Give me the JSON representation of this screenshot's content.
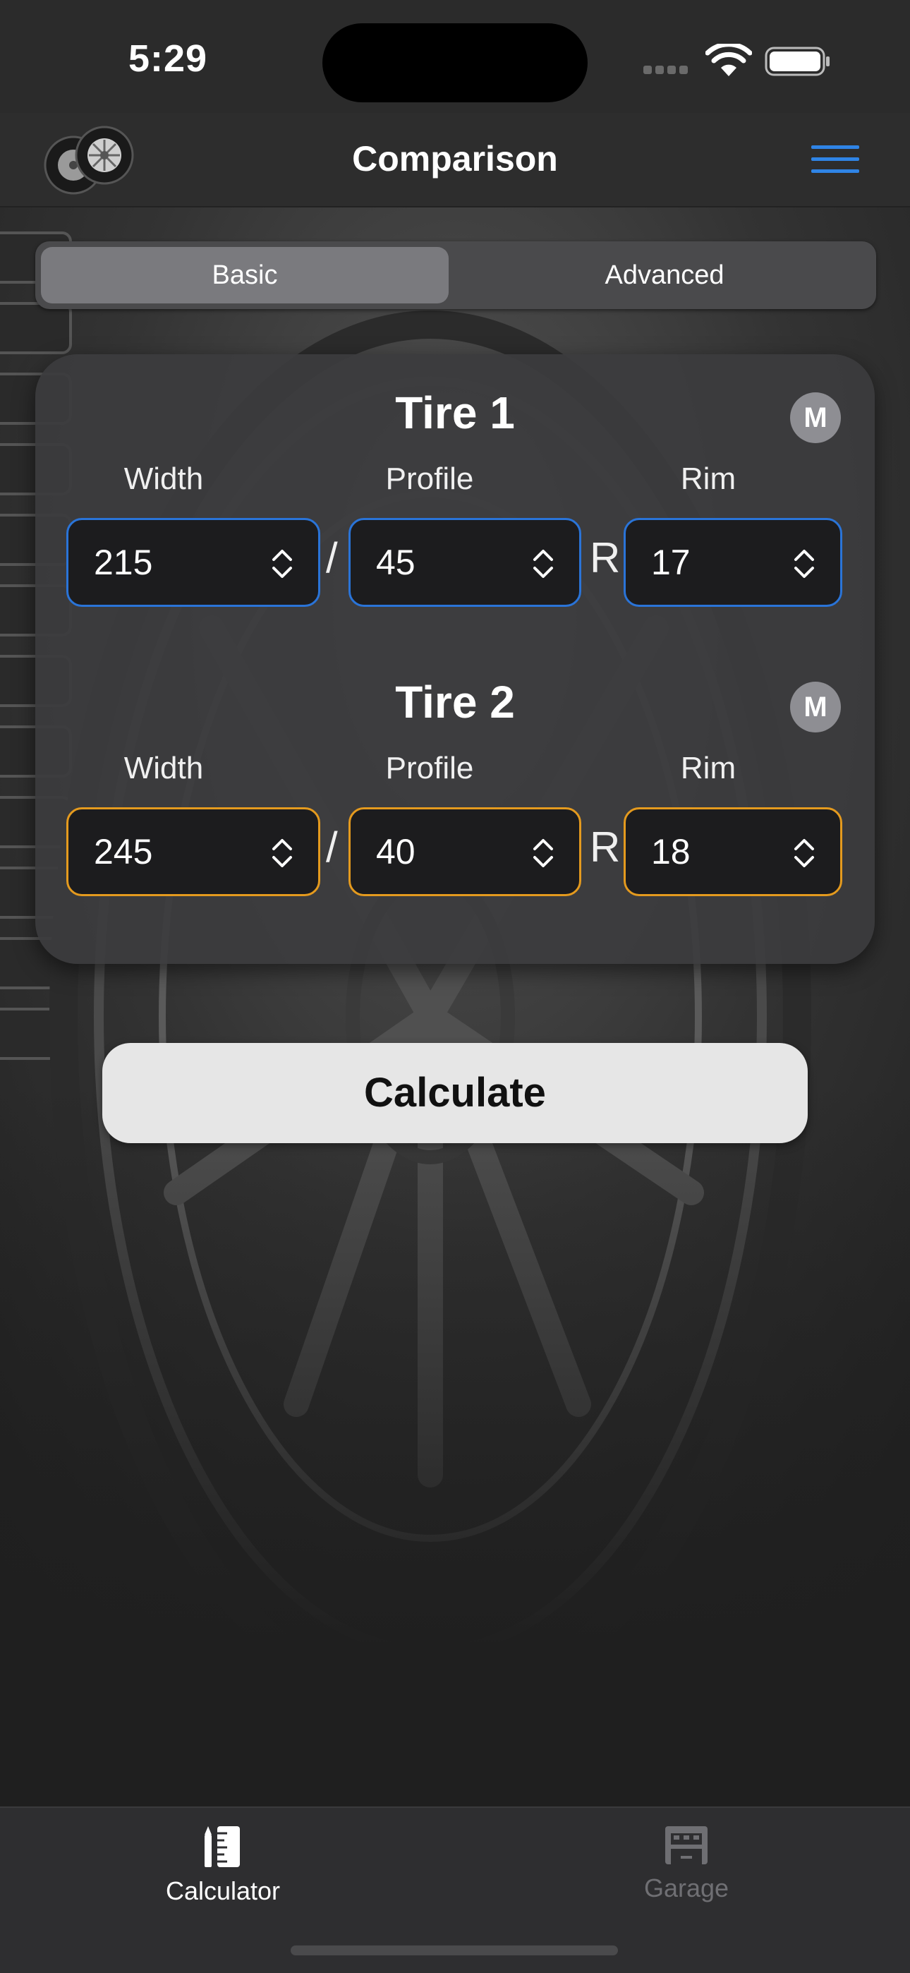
{
  "status_bar": {
    "time": "5:29"
  },
  "nav": {
    "title": "Comparison",
    "logo_icon": "tires-logo-icon",
    "menu_icon": "hamburger-menu-icon",
    "accent_color": "#2f84e6"
  },
  "segments": {
    "basic": "Basic",
    "advanced": "Advanced",
    "selected": "Basic"
  },
  "tires": [
    {
      "title": "Tire 1",
      "badge": "M",
      "border_color": "#2a74d8",
      "labels": {
        "width": "Width",
        "profile": "Profile",
        "rim": "Rim"
      },
      "width": "215",
      "profile": "45",
      "rim": "17",
      "separator": "/",
      "rim_prefix": "R"
    },
    {
      "title": "Tire 2",
      "badge": "M",
      "border_color": "#e49a1e",
      "labels": {
        "width": "Width",
        "profile": "Profile",
        "rim": "Rim"
      },
      "width": "245",
      "profile": "40",
      "rim": "18",
      "separator": "/",
      "rim_prefix": "R"
    }
  ],
  "calculate_label": "Calculate",
  "tab_bar": {
    "items": [
      {
        "label": "Calculator",
        "icon": "ruler-pencil-icon",
        "selected": true
      },
      {
        "label": "Garage",
        "icon": "garage-icon",
        "selected": false
      }
    ]
  }
}
